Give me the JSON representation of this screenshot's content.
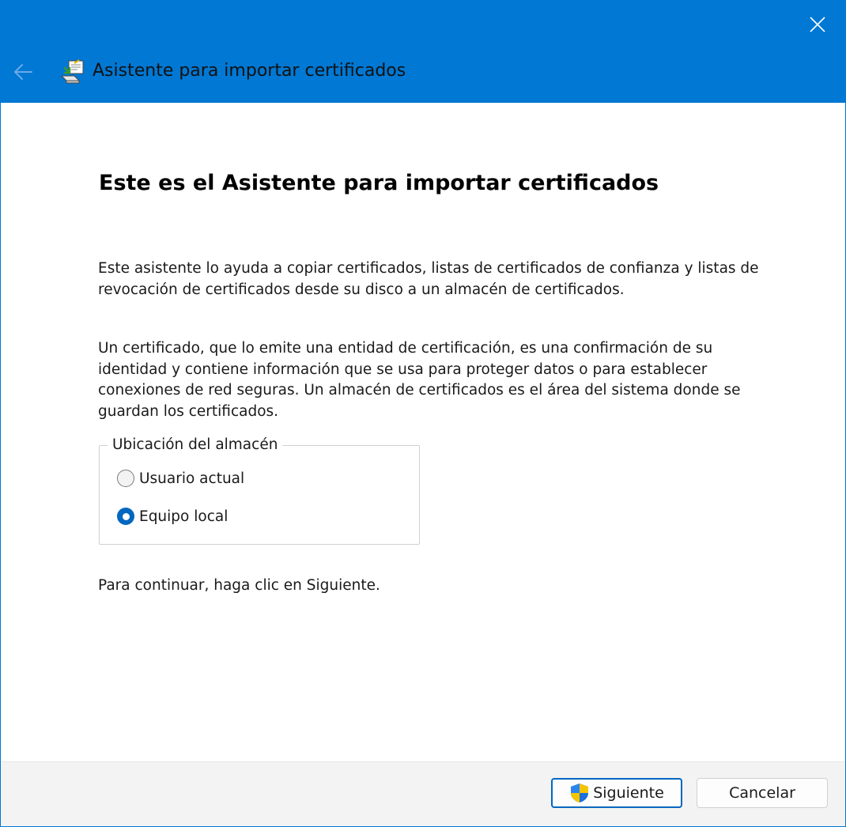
{
  "window": {
    "title": "Asistente para importar certificados",
    "accent_color": "#0078d4"
  },
  "titlebar": {
    "back_icon": "arrow-left-icon",
    "app_icon": "certificate-wizard-icon",
    "close_icon": "close-icon"
  },
  "content": {
    "heading": "Este es el Asistente para importar certificados",
    "paragraph1": "Este asistente lo ayuda a copiar certificados, listas de certificados de confianza y listas de revocación de certificados desde su disco a un almacén de certificados.",
    "paragraph2": "Un certificado, que lo emite una entidad de certificación, es una confirmación de su identidad y contiene información que se usa para proteger datos o para establecer conexiones de red seguras. Un almacén de certificados es el área del sistema donde se guardan los certificados.",
    "store_location": {
      "legend": "Ubicación del almacén",
      "options": [
        {
          "label": "Usuario actual",
          "selected": false
        },
        {
          "label": "Equipo local",
          "selected": true
        }
      ]
    },
    "continue_text": "Para continuar, haga clic en Siguiente."
  },
  "footer": {
    "next_label": "Siguiente",
    "next_icon": "uac-shield-icon",
    "cancel_label": "Cancelar"
  }
}
